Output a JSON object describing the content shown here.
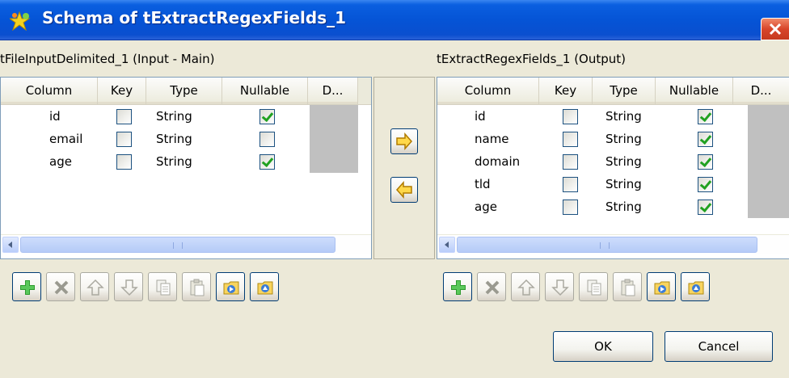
{
  "window": {
    "title": "Schema of tExtractRegexFields_1",
    "close_icon": "close-icon"
  },
  "input_panel": {
    "label": "tFileInputDelimited_1 (Input - Main)",
    "columns": [
      "Column",
      "Key",
      "Type",
      "Nullable",
      "D..."
    ],
    "rows": [
      {
        "column": "id",
        "key": false,
        "type": "String",
        "nullable": true
      },
      {
        "column": "email",
        "key": false,
        "type": "String",
        "nullable": false
      },
      {
        "column": "age",
        "key": false,
        "type": "String",
        "nullable": true
      }
    ]
  },
  "output_panel": {
    "label": "tExtractRegexFields_1 (Output)",
    "columns": [
      "Column",
      "Key",
      "Type",
      "Nullable",
      "D..."
    ],
    "rows": [
      {
        "column": "id",
        "key": false,
        "type": "String",
        "nullable": true
      },
      {
        "column": "name",
        "key": false,
        "type": "String",
        "nullable": true
      },
      {
        "column": "domain",
        "key": false,
        "type": "String",
        "nullable": true
      },
      {
        "column": "tld",
        "key": false,
        "type": "String",
        "nullable": true
      },
      {
        "column": "age",
        "key": false,
        "type": "String",
        "nullable": true
      }
    ]
  },
  "transfer": {
    "copy_right_icon": "arrow-right-icon",
    "copy_left_icon": "arrow-left-icon"
  },
  "toolbar": {
    "icons": [
      "add-icon",
      "remove-icon",
      "move-up-icon",
      "move-down-icon",
      "copy-icon",
      "paste-icon",
      "import-icon",
      "export-icon"
    ]
  },
  "buttons": {
    "ok": "OK",
    "cancel": "Cancel"
  },
  "colors": {
    "titlebar": "#0554d6",
    "check": "#21a121",
    "add_icon": "#2e9a2e"
  }
}
